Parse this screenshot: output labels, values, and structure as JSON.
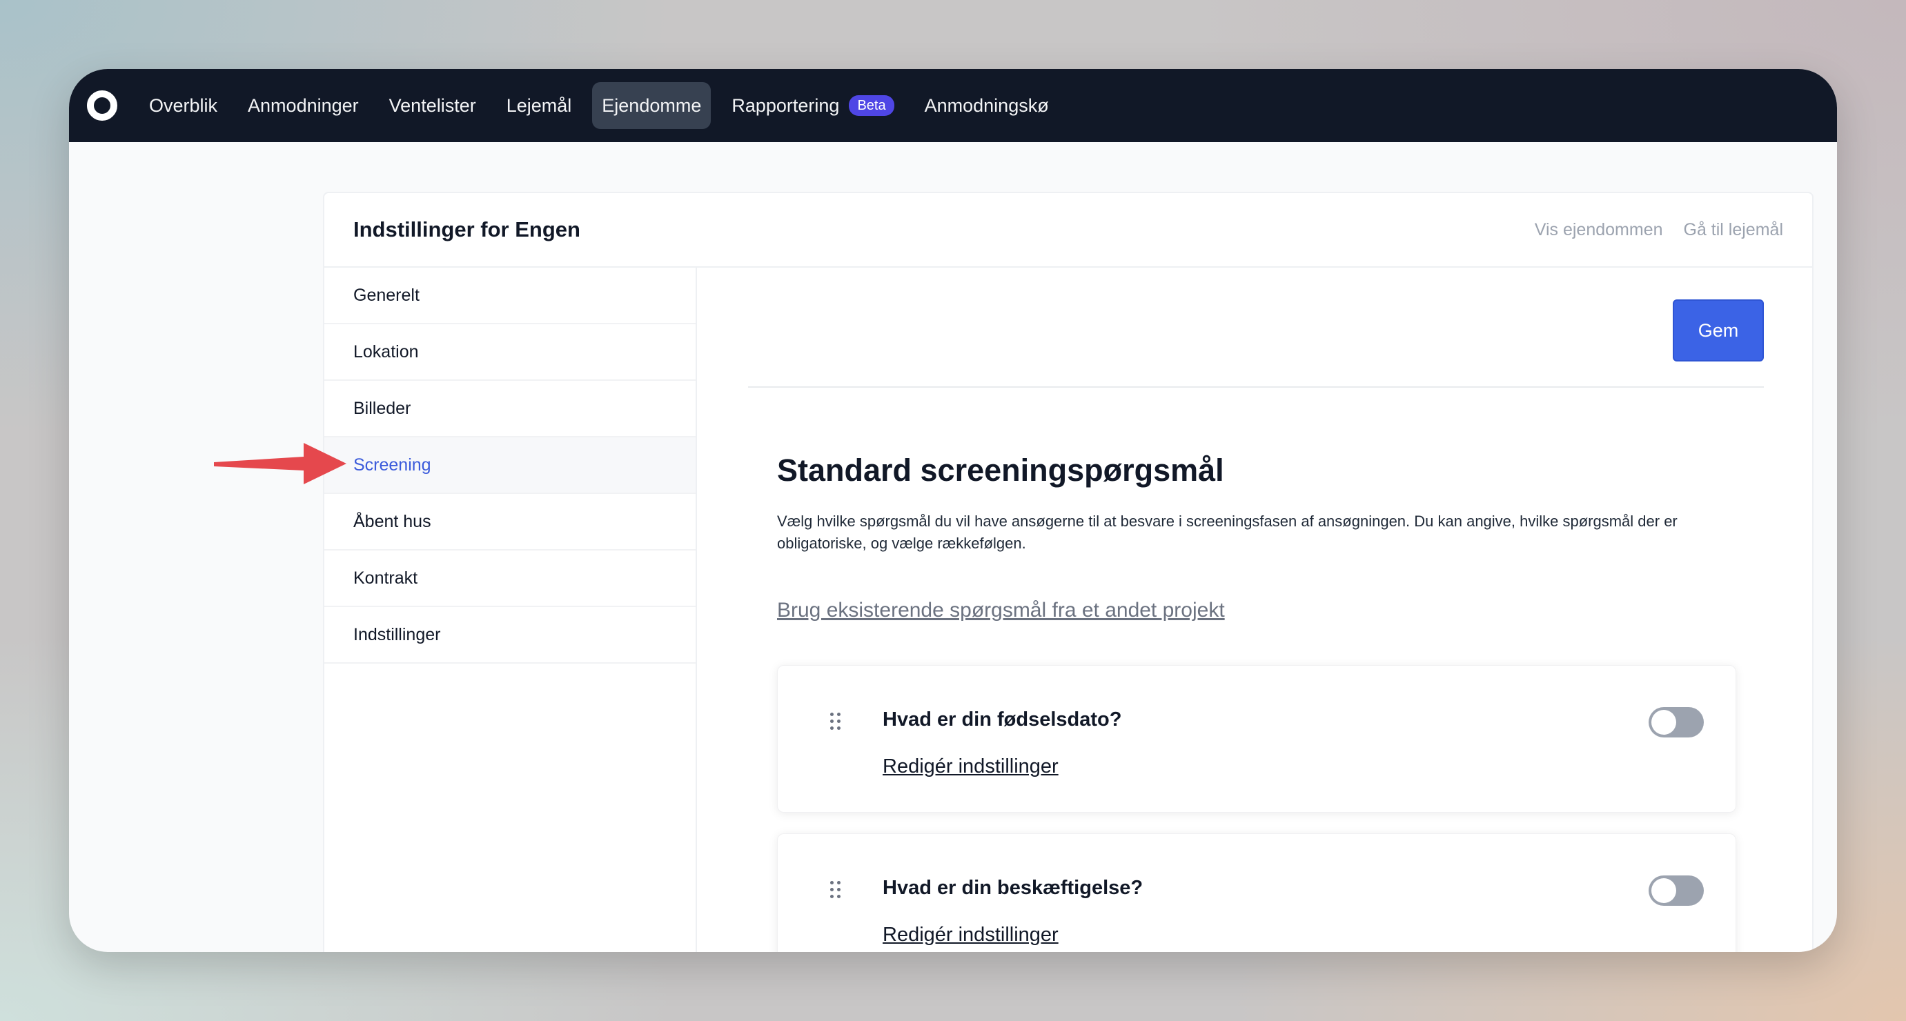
{
  "nav": {
    "items": [
      {
        "label": "Overblik"
      },
      {
        "label": "Anmodninger"
      },
      {
        "label": "Ventelister"
      },
      {
        "label": "Lejemål"
      },
      {
        "label": "Ejendomme",
        "active": true
      },
      {
        "label": "Rapportering",
        "badge": "Beta"
      },
      {
        "label": "Anmodningskø"
      }
    ]
  },
  "header": {
    "title": "Indstillinger for Engen",
    "links": [
      "Vis ejendommen",
      "Gå til lejemål"
    ]
  },
  "sidebar": {
    "items": [
      {
        "label": "Generelt"
      },
      {
        "label": "Lokation"
      },
      {
        "label": "Billeder"
      },
      {
        "label": "Screening",
        "active": true
      },
      {
        "label": "Åbent hus"
      },
      {
        "label": "Kontrakt"
      },
      {
        "label": "Indstillinger"
      }
    ]
  },
  "content": {
    "save_label": "Gem",
    "title": "Standard screeningspørgsmål",
    "description": "Vælg hvilke spørgsmål du vil have ansøgerne til at besvare i screeningsfasen af ansøgningen. Du kan angive, hvilke spørgsmål der er obligatoriske, og vælge rækkefølgen.",
    "reuse_link": "Brug eksisterende spørgsmål fra et andet projekt",
    "questions": [
      {
        "title": "Hvad er din fødselsdato?",
        "edit_label": "Redigér indstillinger",
        "enabled": false
      },
      {
        "title": "Hvad er din beskæftigelse?",
        "edit_label": "Redigér indstillinger",
        "enabled": false
      }
    ]
  },
  "colors": {
    "nav_bg": "#111827",
    "accent": "#3b63e6",
    "badge": "#4f46e5",
    "annotation_arrow": "#e5484d"
  }
}
